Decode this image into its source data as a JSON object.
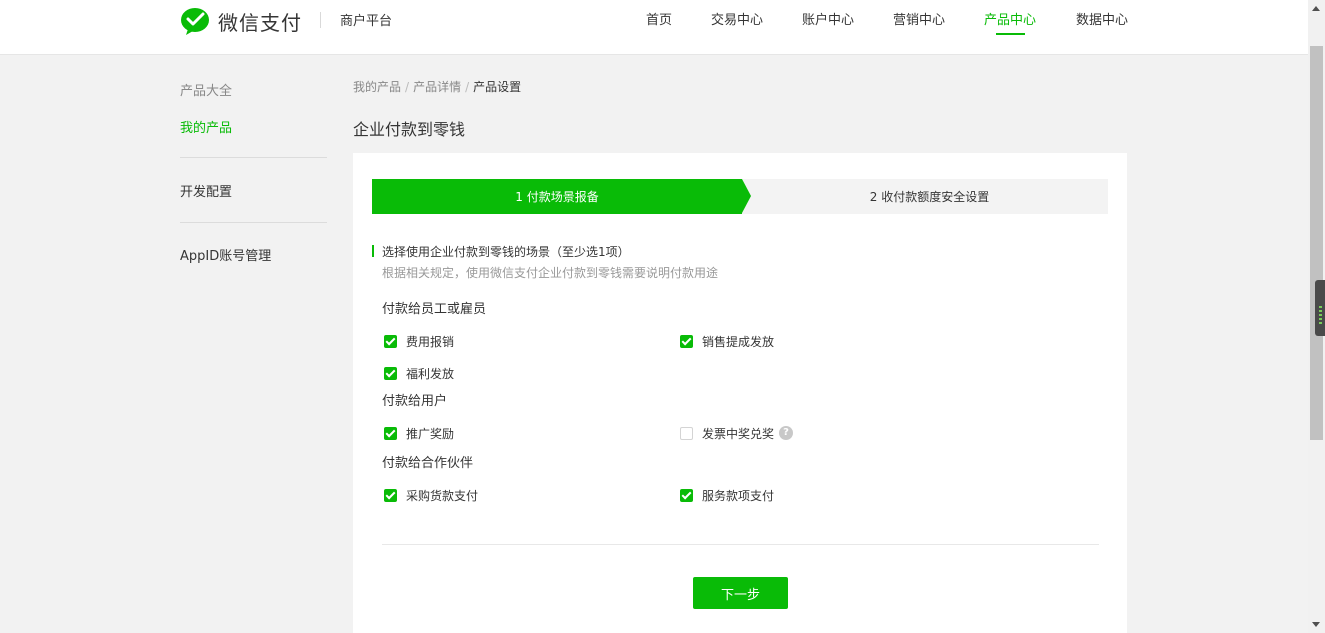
{
  "header": {
    "brand": "微信支付",
    "platform": "商户平台",
    "nav": [
      {
        "label": "首页",
        "active": false
      },
      {
        "label": "交易中心",
        "active": false
      },
      {
        "label": "账户中心",
        "active": false
      },
      {
        "label": "营销中心",
        "active": false
      },
      {
        "label": "产品中心",
        "active": true
      },
      {
        "label": "数据中心",
        "active": false
      }
    ]
  },
  "sidebar": {
    "title": "产品大全",
    "items": [
      {
        "label": "我的产品",
        "active": true
      },
      {
        "label": "开发配置",
        "active": false
      },
      {
        "label": "AppID账号管理",
        "active": false
      }
    ]
  },
  "breadcrumb": [
    "我的产品",
    "产品详情",
    "产品设置"
  ],
  "page_title": "企业付款到零钱",
  "steps": [
    {
      "label": "1 付款场景报备",
      "active": true
    },
    {
      "label": "2 收付款额度安全设置",
      "active": false
    }
  ],
  "section": {
    "title": "选择使用企业付款到零钱的场景（至少选1项）",
    "desc": "根据相关规定，使用微信支付企业付款到零钱需要说明付款用途"
  },
  "groups": [
    {
      "title": "付款给员工或雇员",
      "options": [
        {
          "label": "费用报销",
          "checked": true
        },
        {
          "label": "销售提成发放",
          "checked": true
        },
        {
          "label": "福利发放",
          "checked": true
        }
      ]
    },
    {
      "title": "付款给用户",
      "options": [
        {
          "label": "推广奖励",
          "checked": true
        },
        {
          "label": "发票中奖兑奖",
          "checked": false,
          "help_icon": "question-circle-icon"
        }
      ]
    },
    {
      "title": "付款给合作伙伴",
      "options": [
        {
          "label": "采购货款支付",
          "checked": true
        },
        {
          "label": "服务款项支付",
          "checked": true
        }
      ]
    }
  ],
  "next_button": "下一步",
  "colors": {
    "accent": "#09bb07",
    "text": "#353535",
    "muted": "#888888",
    "background": "#f2f2f2"
  },
  "icons": {
    "logo": "wechat-pay-logo-icon",
    "help": "question-circle-icon",
    "check": "checkbox-checked-icon"
  }
}
